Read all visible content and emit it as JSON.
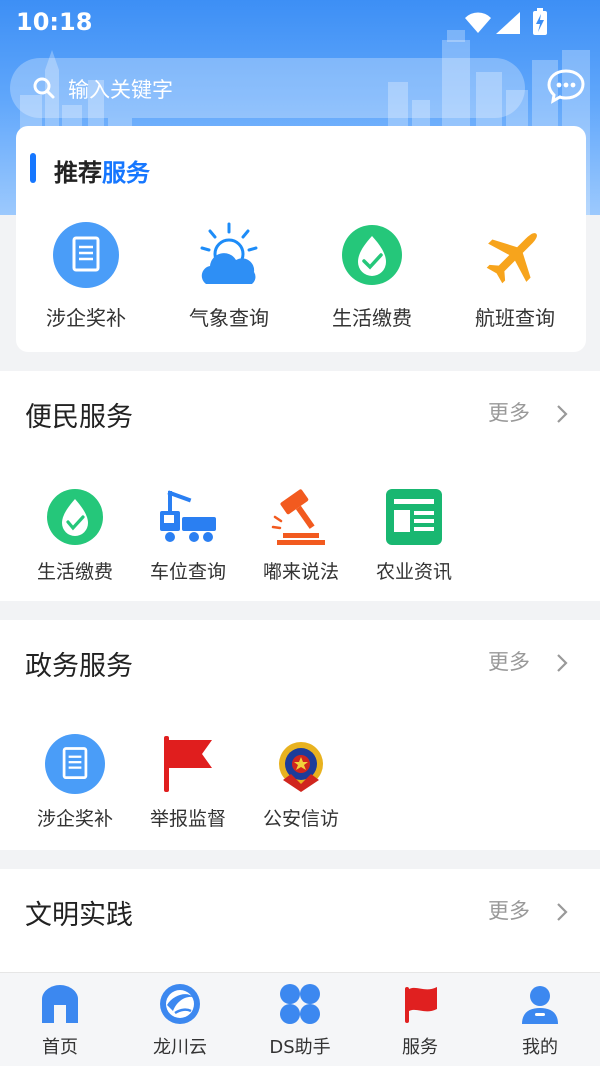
{
  "status_bar": {
    "time": "10:18"
  },
  "search": {
    "placeholder": "输入关键字"
  },
  "recommended": {
    "title_prefix": "推荐",
    "title_accent": "服务",
    "items": [
      {
        "label": "涉企奖补",
        "icon": "document-icon"
      },
      {
        "label": "气象查询",
        "icon": "weather-icon"
      },
      {
        "label": "生活缴费",
        "icon": "payment-icon"
      },
      {
        "label": "航班查询",
        "icon": "airplane-icon"
      }
    ]
  },
  "sections": [
    {
      "title": "便民服务",
      "more": "更多",
      "items": [
        {
          "label": "生活缴费",
          "icon": "payment-icon"
        },
        {
          "label": "车位查询",
          "icon": "truck-icon"
        },
        {
          "label": "嘟来说法",
          "icon": "gavel-icon"
        },
        {
          "label": "农业资讯",
          "icon": "news-icon"
        }
      ]
    },
    {
      "title": "政务服务",
      "more": "更多",
      "items": [
        {
          "label": "涉企奖补",
          "icon": "document-icon"
        },
        {
          "label": "举报监督",
          "icon": "flag-icon"
        },
        {
          "label": "公安信访",
          "icon": "police-badge-icon"
        }
      ]
    },
    {
      "title": "文明实践",
      "more": "更多",
      "items": []
    }
  ],
  "tabs": [
    {
      "label": "首页",
      "icon": "home-icon"
    },
    {
      "label": "龙川云",
      "icon": "cloud-logo-icon"
    },
    {
      "label": "DS助手",
      "icon": "grid-icon"
    },
    {
      "label": "服务",
      "icon": "flag-icon",
      "active": true
    },
    {
      "label": "我的",
      "icon": "user-icon"
    }
  ],
  "colors": {
    "accent": "#1677ff",
    "active_tab": "#e02020"
  }
}
